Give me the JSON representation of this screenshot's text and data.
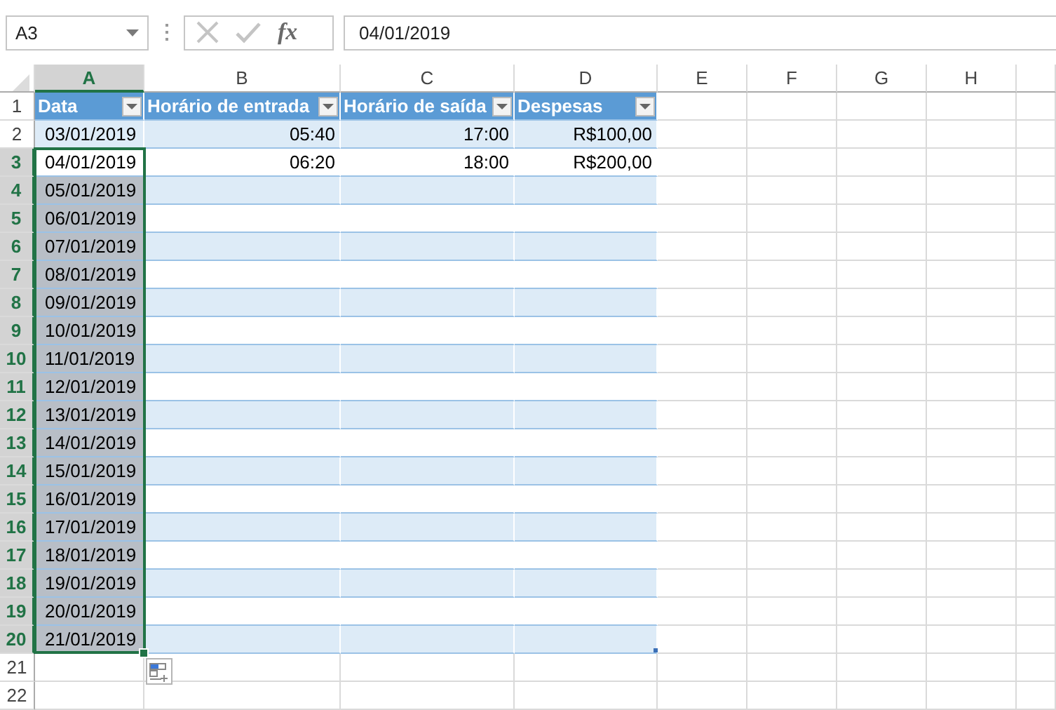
{
  "name_box": "A3",
  "formula_bar": {
    "function_label": "fx",
    "value": "04/01/2019"
  },
  "columns": [
    {
      "letter": "A",
      "selected": true
    },
    {
      "letter": "B",
      "selected": false
    },
    {
      "letter": "C",
      "selected": false
    },
    {
      "letter": "D",
      "selected": false
    },
    {
      "letter": "E",
      "selected": false
    },
    {
      "letter": "F",
      "selected": false
    },
    {
      "letter": "G",
      "selected": false
    },
    {
      "letter": "H",
      "selected": false
    }
  ],
  "rows": [
    {
      "number": "1",
      "selected": false,
      "kind": "table-header",
      "cells": [
        "Data",
        "Horário de entrada",
        "Horário de saída",
        "Despesas"
      ]
    },
    {
      "number": "2",
      "selected": false,
      "kind": "table-row",
      "cells": [
        "03/01/2019",
        "05:40",
        "17:00",
        "R$100,00"
      ]
    },
    {
      "number": "3",
      "selected": true,
      "kind": "table-row",
      "cells": [
        "04/01/2019",
        "06:20",
        "18:00",
        "R$200,00"
      ]
    },
    {
      "number": "4",
      "selected": true,
      "kind": "table-row",
      "cells": [
        "05/01/2019"
      ]
    },
    {
      "number": "5",
      "selected": true,
      "kind": "table-row",
      "cells": [
        "06/01/2019"
      ]
    },
    {
      "number": "6",
      "selected": true,
      "kind": "table-row",
      "cells": [
        "07/01/2019"
      ]
    },
    {
      "number": "7",
      "selected": true,
      "kind": "table-row",
      "cells": [
        "08/01/2019"
      ]
    },
    {
      "number": "8",
      "selected": true,
      "kind": "table-row",
      "cells": [
        "09/01/2019"
      ]
    },
    {
      "number": "9",
      "selected": true,
      "kind": "table-row",
      "cells": [
        "10/01/2019"
      ]
    },
    {
      "number": "10",
      "selected": true,
      "kind": "table-row",
      "cells": [
        "11/01/2019"
      ]
    },
    {
      "number": "11",
      "selected": true,
      "kind": "table-row",
      "cells": [
        "12/01/2019"
      ]
    },
    {
      "number": "12",
      "selected": true,
      "kind": "table-row",
      "cells": [
        "13/01/2019"
      ]
    },
    {
      "number": "13",
      "selected": true,
      "kind": "table-row",
      "cells": [
        "14/01/2019"
      ]
    },
    {
      "number": "14",
      "selected": true,
      "kind": "table-row",
      "cells": [
        "15/01/2019"
      ]
    },
    {
      "number": "15",
      "selected": true,
      "kind": "table-row",
      "cells": [
        "16/01/2019"
      ]
    },
    {
      "number": "16",
      "selected": true,
      "kind": "table-row",
      "cells": [
        "17/01/2019"
      ]
    },
    {
      "number": "17",
      "selected": true,
      "kind": "table-row",
      "cells": [
        "18/01/2019"
      ]
    },
    {
      "number": "18",
      "selected": true,
      "kind": "table-row",
      "cells": [
        "19/01/2019"
      ]
    },
    {
      "number": "19",
      "selected": true,
      "kind": "table-row",
      "cells": [
        "20/01/2019"
      ]
    },
    {
      "number": "20",
      "selected": true,
      "kind": "table-row",
      "cells": [
        "21/01/2019"
      ]
    },
    {
      "number": "21",
      "selected": false,
      "kind": "empty",
      "cells": []
    },
    {
      "number": "22",
      "selected": false,
      "kind": "empty",
      "cells": []
    }
  ]
}
